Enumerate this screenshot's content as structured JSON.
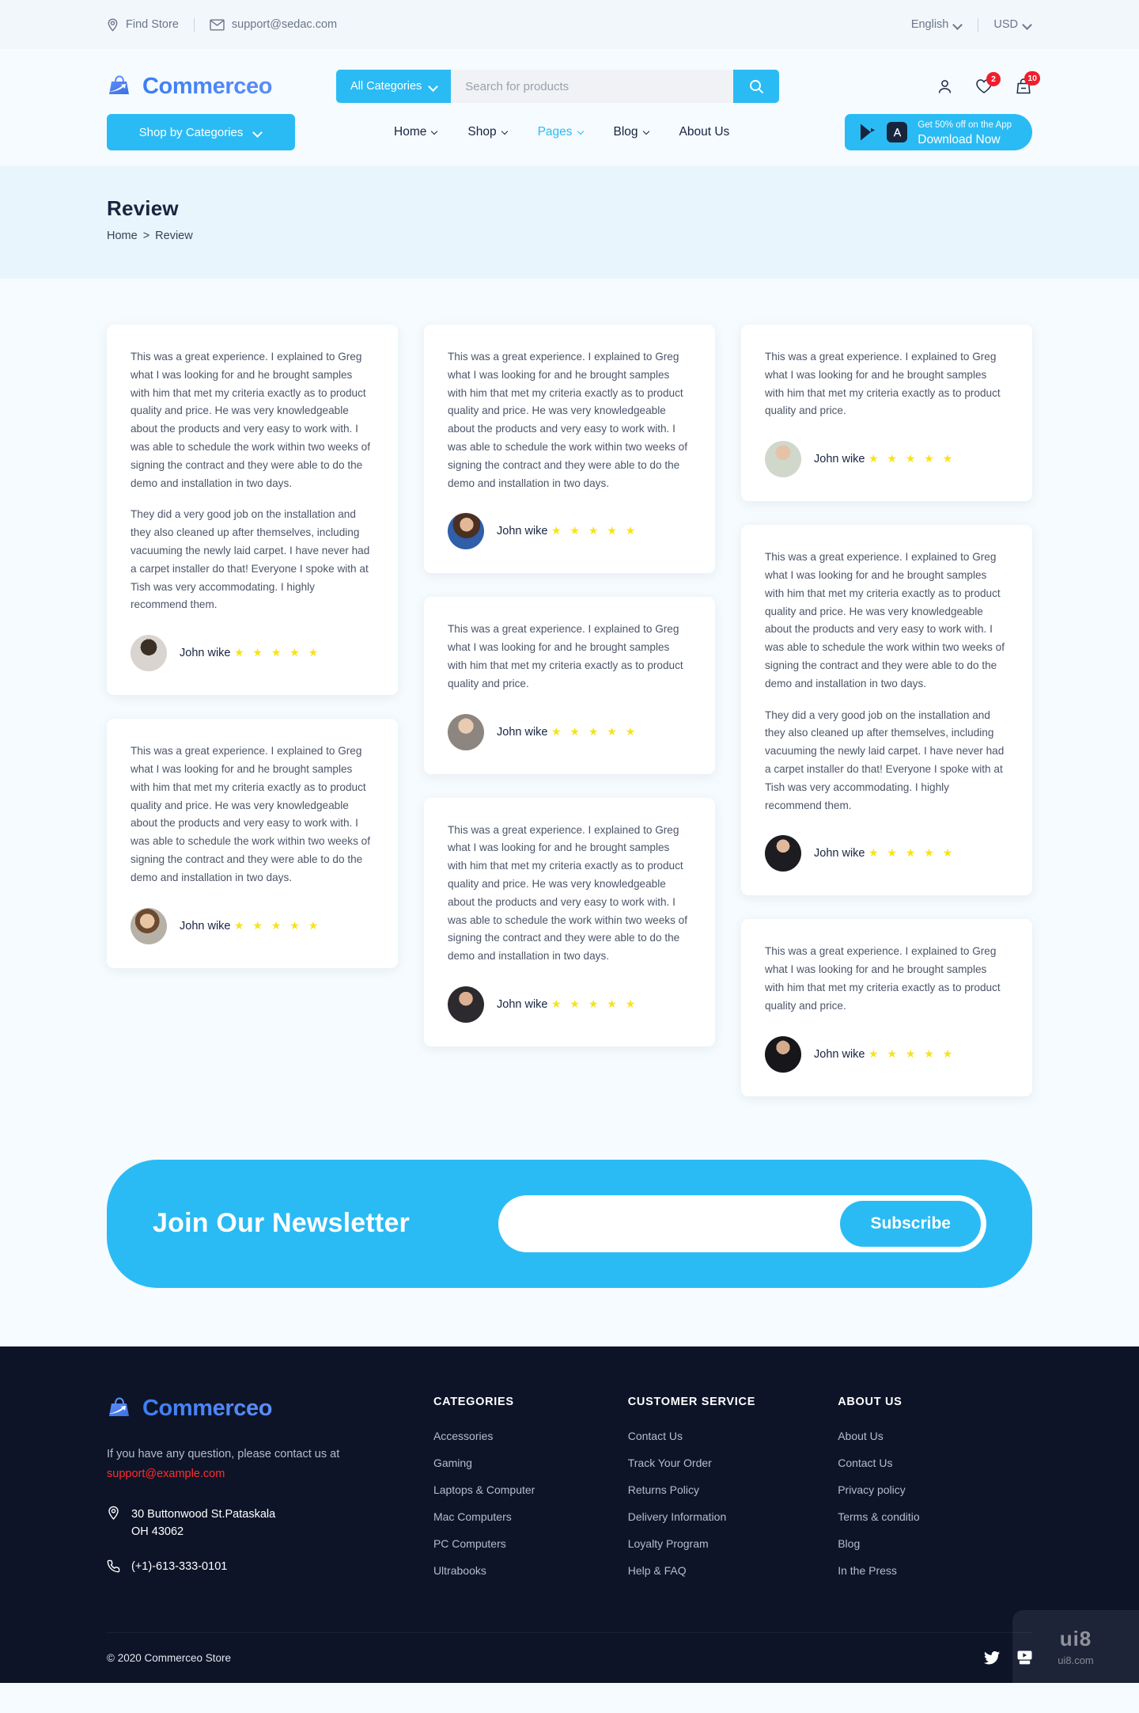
{
  "topbar": {
    "find_store": "Find Store",
    "email": "support@sedac.com",
    "language": "English",
    "currency": "USD"
  },
  "header": {
    "brand": "Commerceo",
    "category_label": "All Categories",
    "search_placeholder": "Search for products",
    "search_value": "",
    "wishlist_count": "2",
    "cart_count": "10"
  },
  "nav": {
    "shop_by_categories": "Shop by Categories",
    "items": [
      {
        "label": "Home",
        "has_caret": true,
        "active": false
      },
      {
        "label": "Shop",
        "has_caret": true,
        "active": false
      },
      {
        "label": "Pages",
        "has_caret": true,
        "active": true
      },
      {
        "label": "Blog",
        "has_caret": true,
        "active": false
      },
      {
        "label": "About Us",
        "has_caret": false,
        "active": false
      }
    ],
    "app_line1": "Get 50% off on the App",
    "app_line2": "Download Now"
  },
  "breadcrumb": {
    "title": "Review",
    "home": "Home",
    "separator": ">",
    "current": "Review"
  },
  "reviews": {
    "author_name": "John wike",
    "stars": "★ ★ ★ ★ ★",
    "para_long": "This was a great experience. I explained to Greg what I was looking for and he brought samples with him that met my criteria exactly as to product quality and price. He was very knowledgeable about the products and very easy to work with. I was able to schedule the work within two weeks of signing the contract and they were able to do the demo and installation in two days.",
    "para_short": "This was a great experience. I explained to Greg what I was looking for and he brought samples with him that met my criteria exactly as to product quality and price.",
    "para_second": "They did a very good job on the installation and they also cleaned up after themselves, including vacuuming the newly laid carpet. I have never had a carpet installer do that! Everyone I spoke with at Tish was very accommodating. I highly recommend them."
  },
  "newsletter": {
    "title": "Join Our Newsletter",
    "input_value": "",
    "input_placeholder": "",
    "button": "Subscribe"
  },
  "footer": {
    "brand": "Commerceo",
    "question_text": "If you have any question, please contact us at",
    "email": "support@example.com",
    "address_line1": "30 Buttonwood St.Pataskala",
    "address_line2": "OH 43062",
    "phone": "(+1)-613-333-0101",
    "columns": [
      {
        "title": "CATEGORIES",
        "links": [
          "Accessories",
          "Gaming",
          "Laptops & Computer",
          "Mac Computers",
          "PC Computers",
          "Ultrabooks"
        ]
      },
      {
        "title": "CUSTOMER SERVICE",
        "links": [
          "Contact Us",
          "Track Your Order",
          "Returns Policy",
          "Delivery Information",
          "Loyalty Program",
          "Help & FAQ"
        ]
      },
      {
        "title": "ABOUT US",
        "links": [
          "About Us",
          "Contact Us",
          "Privacy policy",
          "Terms & conditio",
          "Blog",
          "In the Press"
        ]
      }
    ],
    "copyright": "© 2020 Commerceo Store"
  },
  "watermark": {
    "top": "ui8",
    "bottom": "ui8.com"
  },
  "colors": {
    "accent": "#2bbbf4",
    "brand_blue": "#3c7ef3",
    "badge_red": "#f01e2c",
    "star_yellow": "#f7e318",
    "footer_bg": "#0d1428",
    "page_bg": "#f5fbfe",
    "band_bg": "#e9f5fc"
  }
}
